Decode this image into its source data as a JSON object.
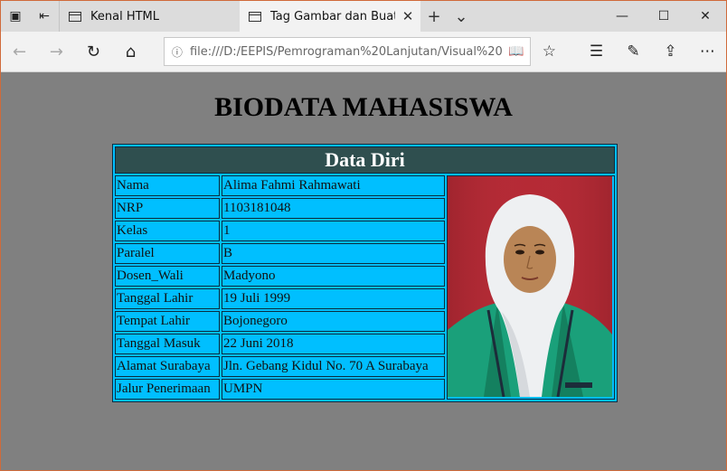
{
  "browser": {
    "tabs": [
      {
        "title": "Kenal HTML",
        "active": false
      },
      {
        "title": "Tag Gambar dan Buat Ta",
        "active": true
      }
    ],
    "address": "file:///D:/EEPIS/Pemrograman%20Lanjutan/Visual%20"
  },
  "page": {
    "heading": "BIODATA MAHASISWA",
    "table_caption": "Data Diri",
    "rows": [
      {
        "label": "Nama",
        "value": "Alima Fahmi Rahmawati"
      },
      {
        "label": "NRP",
        "value": "1103181048"
      },
      {
        "label": "Kelas",
        "value": "1"
      },
      {
        "label": "Paralel",
        "value": "B"
      },
      {
        "label": "Dosen_Wali",
        "value": "Madyono"
      },
      {
        "label": "Tanggal Lahir",
        "value": "19 Juli 1999"
      },
      {
        "label": "Tempat Lahir",
        "value": "Bojonegoro"
      },
      {
        "label": "Tanggal Masuk",
        "value": "22 Juni 2018"
      },
      {
        "label": "Alamat Surabaya",
        "value": "Jln. Gebang Kidul No. 70 A Surabaya"
      },
      {
        "label": "Jalur Penerimaan",
        "value": "UMPN"
      }
    ]
  },
  "colors": {
    "page_bg": "#808080",
    "table_bg": "#00bfff",
    "header_bg": "#2f4f4f",
    "photo_bg": "#b52a35"
  }
}
